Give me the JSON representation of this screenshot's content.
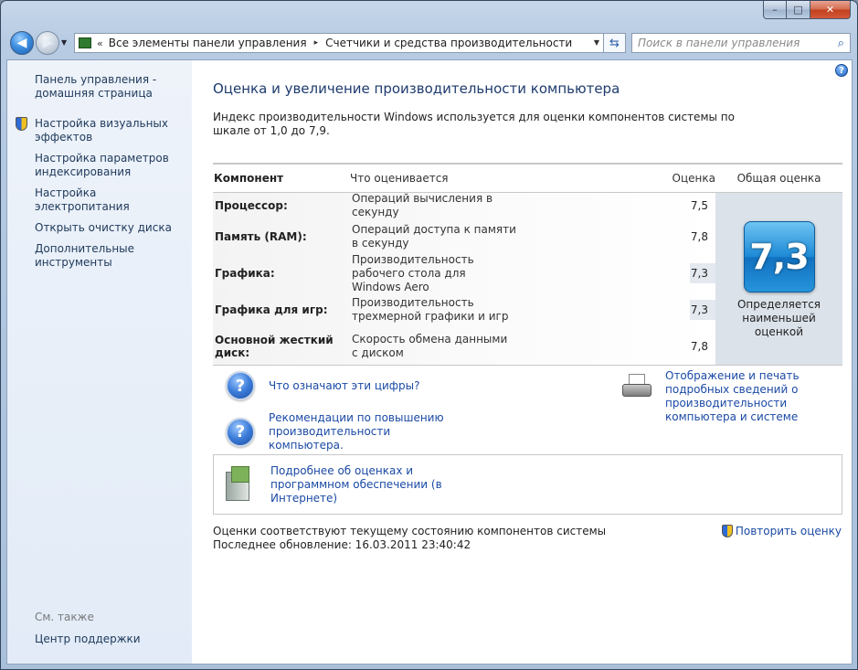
{
  "window": {
    "caption": {
      "minimize": "–",
      "maximize": "□",
      "close": "✕"
    }
  },
  "nav": {
    "address_chevron": "«",
    "breadcrumb": [
      "Все элементы панели управления",
      "Счетчики и средства производительности"
    ],
    "breadcrumb_sep": "▸",
    "search_placeholder": "Поиск в панели управления"
  },
  "sidebar": {
    "home": "Панель управления - домашняя страница",
    "items": [
      {
        "label": "Настройка визуальных эффектов",
        "shield": true
      },
      {
        "label": "Настройка параметров индексирования",
        "shield": false
      },
      {
        "label": "Настройка электропитания",
        "shield": false
      },
      {
        "label": "Открыть очистку диска",
        "shield": false
      },
      {
        "label": "Дополнительные инструменты",
        "shield": false
      }
    ],
    "see_also": "См. также",
    "support_center": "Центр поддержки"
  },
  "main": {
    "title": "Оценка и увеличение производительности компьютера",
    "intro": "Индекс производительности Windows используется для оценки компонентов системы по шкале от 1,0 до 7,9.",
    "table": {
      "headers": {
        "component": "Компонент",
        "what": "Что оценивается",
        "score": "Оценка",
        "total": "Общая оценка"
      },
      "rows": [
        {
          "component": "Процессор:",
          "what": "Операций вычисления в секунду",
          "score": "7,5",
          "lowest": false
        },
        {
          "component": "Память (RAM):",
          "what": "Операций доступа к памяти в секунду",
          "score": "7,8",
          "lowest": false
        },
        {
          "component": "Графика:",
          "what": "Производительность рабочего стола для Windows Aero",
          "score": "7,3",
          "lowest": true
        },
        {
          "component": "Графика для игр:",
          "what": "Производительность трехмерной графики и игр",
          "score": "7,3",
          "lowest": true
        },
        {
          "component": "Основной жесткий диск:",
          "what": "Скорость обмена данными с диском",
          "score": "7,8",
          "lowest": false
        }
      ],
      "total_score": "7,3",
      "total_caption": "Определяется наименьшей оценкой"
    },
    "links": {
      "what_numbers_mean": "Что означают эти цифры?",
      "tips": "Рекомендации по повышению производительности компьютера.",
      "print_details": "Отображение и печать подробных сведений о производительности компьютера и системе",
      "more_info_online": "Подробнее об оценках и программном обеспечении (в Интернете)"
    },
    "status": {
      "line1": "Оценки соответствуют текущему состоянию компонентов системы",
      "last_update": "Последнее обновление: 16.03.2011 23:40:42"
    },
    "rescore": "Повторить оценку"
  }
}
